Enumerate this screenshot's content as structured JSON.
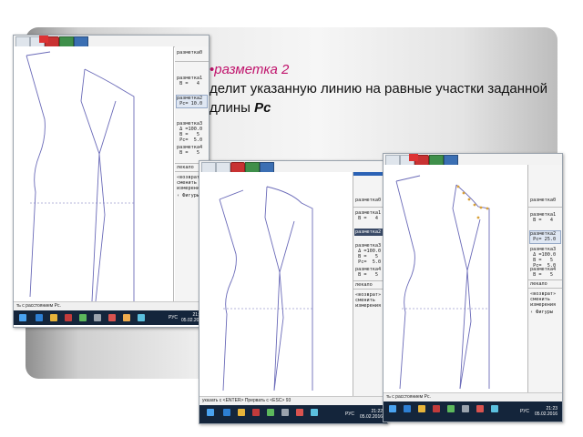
{
  "slide": {
    "bullet_title": "разметка 2",
    "bullet_text": "делит указанную линию  на равные участки заданной длины ",
    "bullet_param": "Рс"
  },
  "screenshots": [
    {
      "panel": {
        "items": [
          "разметка0",
          "разметка1\n В =   4",
          "разметка2\n Рс= 10.0",
          "разметка3\n Δ =100.0\n В =   5\n Рс=  5.0",
          "разметка4\n В =   5"
        ],
        "tool_label": "лекало",
        "tool_text": "«возврат»\nсменить\nизмерения",
        "bottom": "‹ Фигуры"
      },
      "status_text": "ть с расстоянием Рс.",
      "clock_time": "21:20",
      "clock_date": "05.02.2016",
      "lang": "РУС"
    },
    {
      "panel": {
        "items": [
          "разметка0",
          "разметка1\n В =   4",
          "разметка2",
          "разметка3\n Δ =100.0\n В =   5\n Рс=  5.0",
          "разметка4\n В =   5"
        ],
        "tool_label": "лекало",
        "tool_text": "«возврат»\nсменить\nизмерения",
        "bottom": ""
      },
      "status_text": "указать с <ENTER> Прервать с <ESC> 93",
      "clock_time": "21:22",
      "clock_date": "05.02.2016",
      "lang": "РУС"
    },
    {
      "panel": {
        "items": [
          "разметка0",
          "разметка1\n В =   4",
          "разметка2\n Рс= 25.0",
          "разметка3\n Δ =100.0\n В =   5\n Рс=  5.0",
          "разметка4\n В =   5"
        ],
        "tool_label": "лекало",
        "tool_text": "«возврат»\nсменить\nизмерения",
        "bottom": "‹ Фигуры"
      },
      "status_text": "ть с расстоянием Рс.",
      "clock_time": "21:23",
      "clock_date": "05.02.2016",
      "lang": "РУС"
    }
  ]
}
